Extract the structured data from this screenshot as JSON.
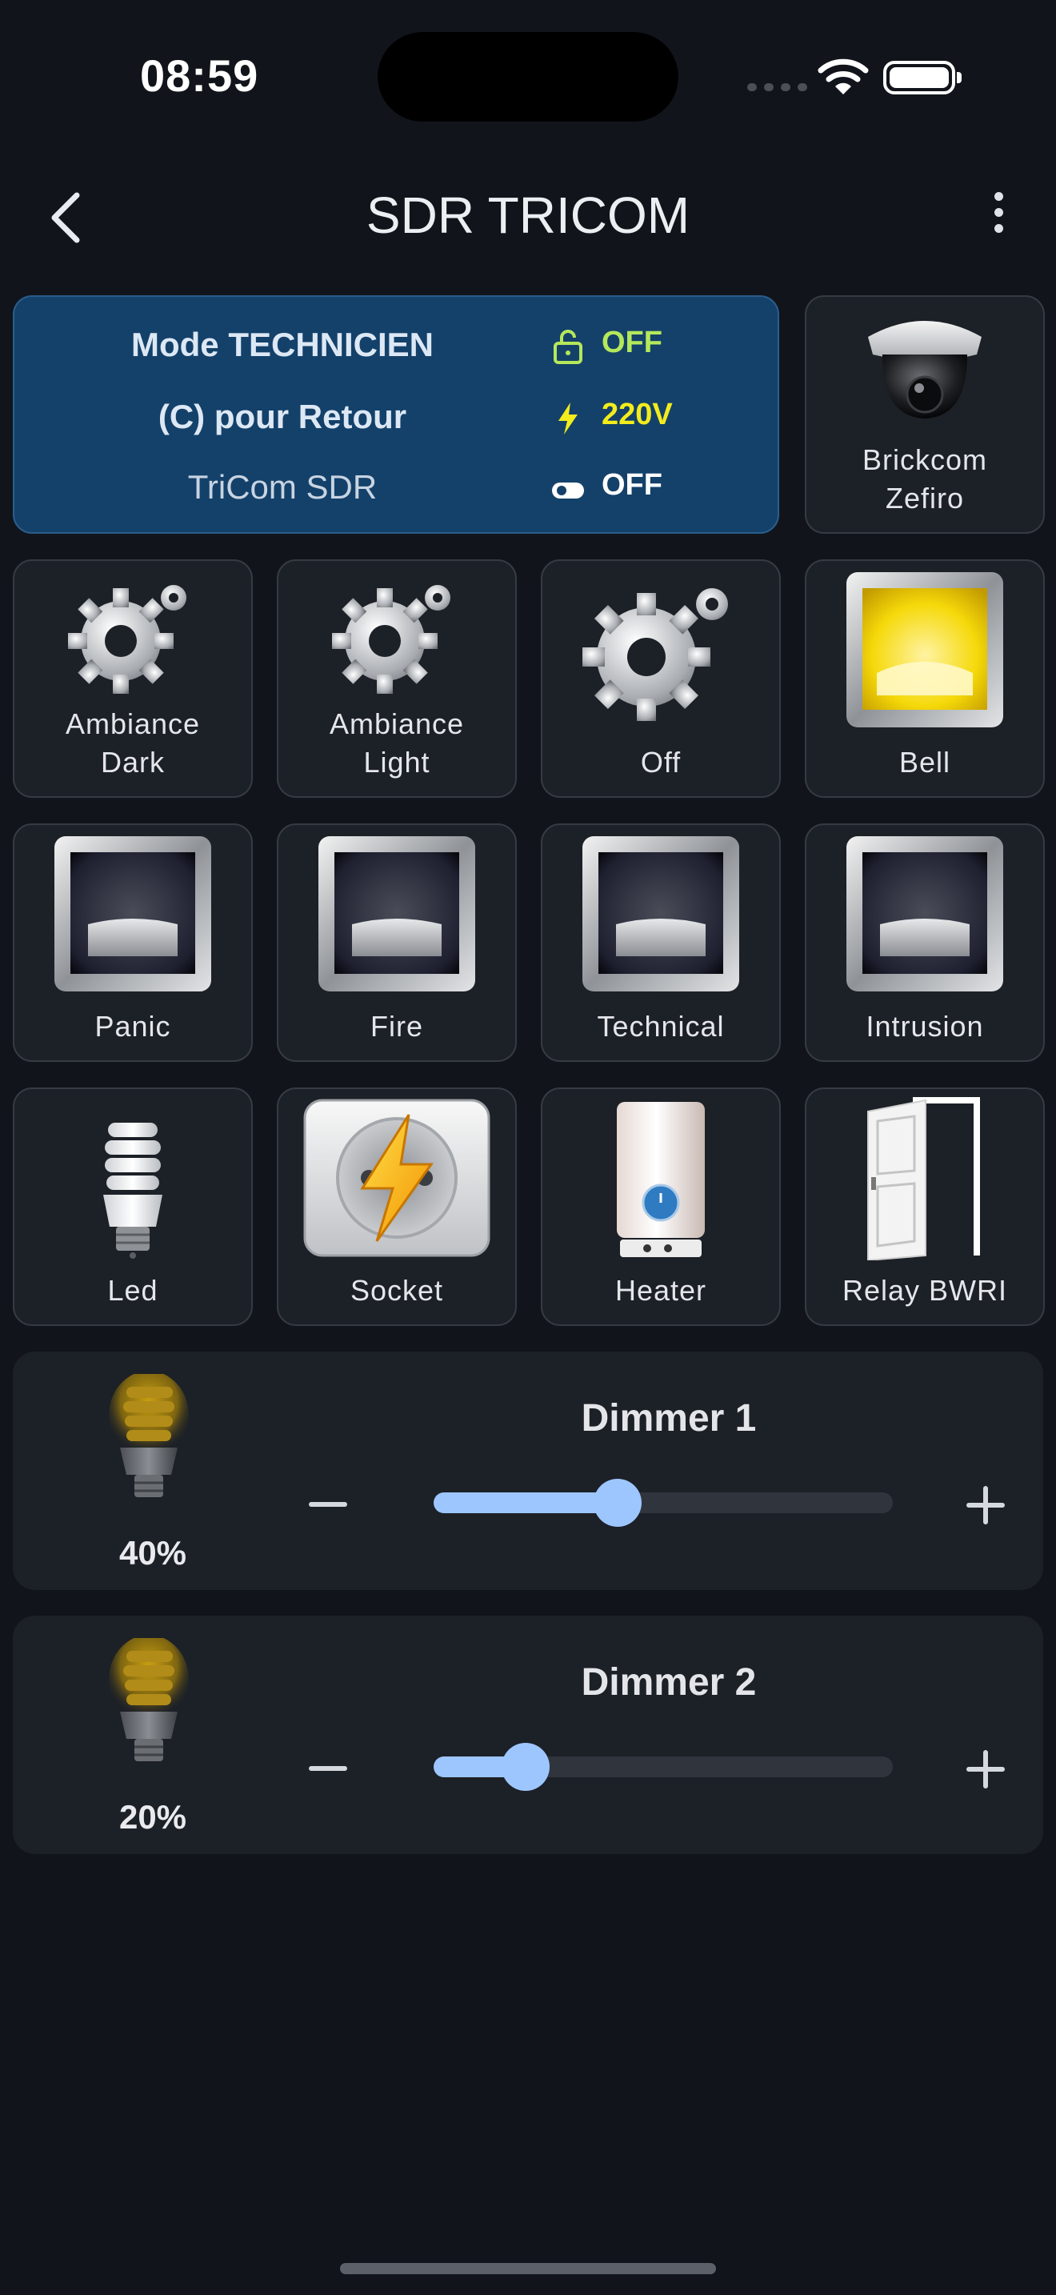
{
  "status_bar": {
    "time": "08:59"
  },
  "header": {
    "title": "SDR TRICOM",
    "back_icon": "chevron-left-icon",
    "menu_icon": "more-vertical-icon"
  },
  "info": {
    "rows": [
      {
        "label": "Mode TECHNICIEN",
        "icon": "lock-open-icon",
        "value": "OFF",
        "color": "#b5e85a"
      },
      {
        "label": "(C) pour Retour",
        "icon": "bolt-icon",
        "value": "220V",
        "color": "#f2ec1c"
      },
      {
        "label": "TriCom SDR",
        "icon": "toggle-icon",
        "value": "OFF",
        "color": "#ffffff"
      }
    ]
  },
  "tiles": {
    "camera": {
      "line1": "Brickcom",
      "line2": "Zefiro"
    },
    "ambiance_dark": {
      "line1": "Ambiance",
      "line2": "Dark"
    },
    "ambiance_light": {
      "line1": "Ambiance",
      "line2": "Light"
    },
    "off": {
      "line1": "Off"
    },
    "bell": {
      "line1": "Bell"
    },
    "panic": {
      "line1": "Panic"
    },
    "fire": {
      "line1": "Fire"
    },
    "technical": {
      "line1": "Technical"
    },
    "intrusion": {
      "line1": "Intrusion"
    },
    "led": {
      "line1": "Led"
    },
    "socket": {
      "line1": "Socket"
    },
    "heater": {
      "line1": "Heater"
    },
    "relay": {
      "line1": "Relay BWRI"
    }
  },
  "dimmers": [
    {
      "name": "Dimmer 1",
      "percent_label": "40%",
      "value": 0.4
    },
    {
      "name": "Dimmer 2",
      "percent_label": "20%",
      "value": 0.2
    }
  ],
  "colors": {
    "background": "#11151b",
    "tile": "#1c2027",
    "info_card": "#14416a",
    "slider": "#9dc6ff",
    "bell_on": "#f5d90a"
  }
}
